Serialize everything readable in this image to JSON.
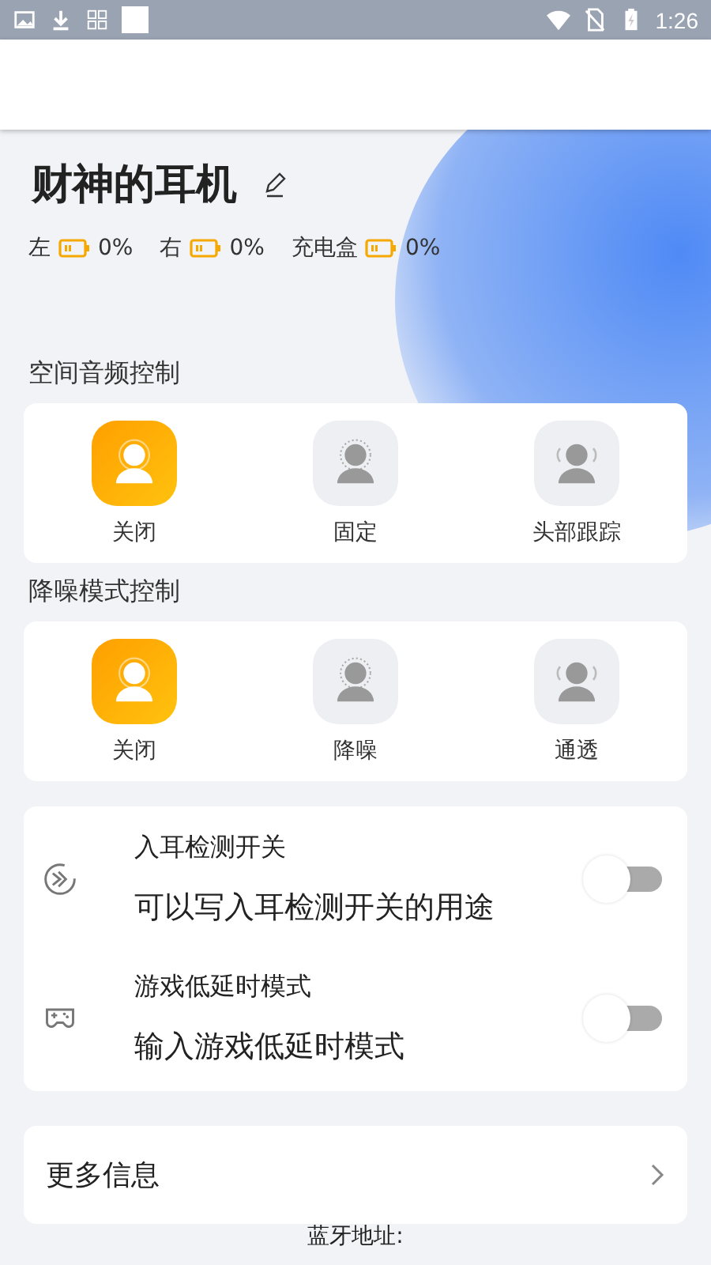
{
  "status_bar": {
    "time": "1:26"
  },
  "device": {
    "name": "财神的耳机"
  },
  "batteries": [
    {
      "label": "左",
      "reading": "0%"
    },
    {
      "label": "右",
      "reading": "0%"
    },
    {
      "label": "充电盒",
      "reading": "0%"
    }
  ],
  "sections": [
    {
      "title": "空间音频控制",
      "options": [
        {
          "label": "关闭",
          "kind": "plain",
          "selected": true
        },
        {
          "label": "固定",
          "kind": "dotted",
          "selected": false
        },
        {
          "label": "头部跟踪",
          "kind": "waves",
          "selected": false
        }
      ]
    },
    {
      "title": "降噪模式控制",
      "options": [
        {
          "label": "关闭",
          "kind": "plain",
          "selected": true
        },
        {
          "label": "降噪",
          "kind": "dotted",
          "selected": false
        },
        {
          "label": "通透",
          "kind": "waves",
          "selected": false
        }
      ]
    }
  ],
  "toggles": [
    {
      "kind": "ear",
      "title": "入耳检测开关",
      "description": "可以写入耳检测开关的用途",
      "on": false
    },
    {
      "kind": "gamepad",
      "title": "游戏低延时模式",
      "description": "输入游戏低延时模式",
      "on": false
    }
  ],
  "more_info": {
    "label": "更多信息"
  },
  "bluetooth": {
    "label": "蓝牙地址:"
  }
}
